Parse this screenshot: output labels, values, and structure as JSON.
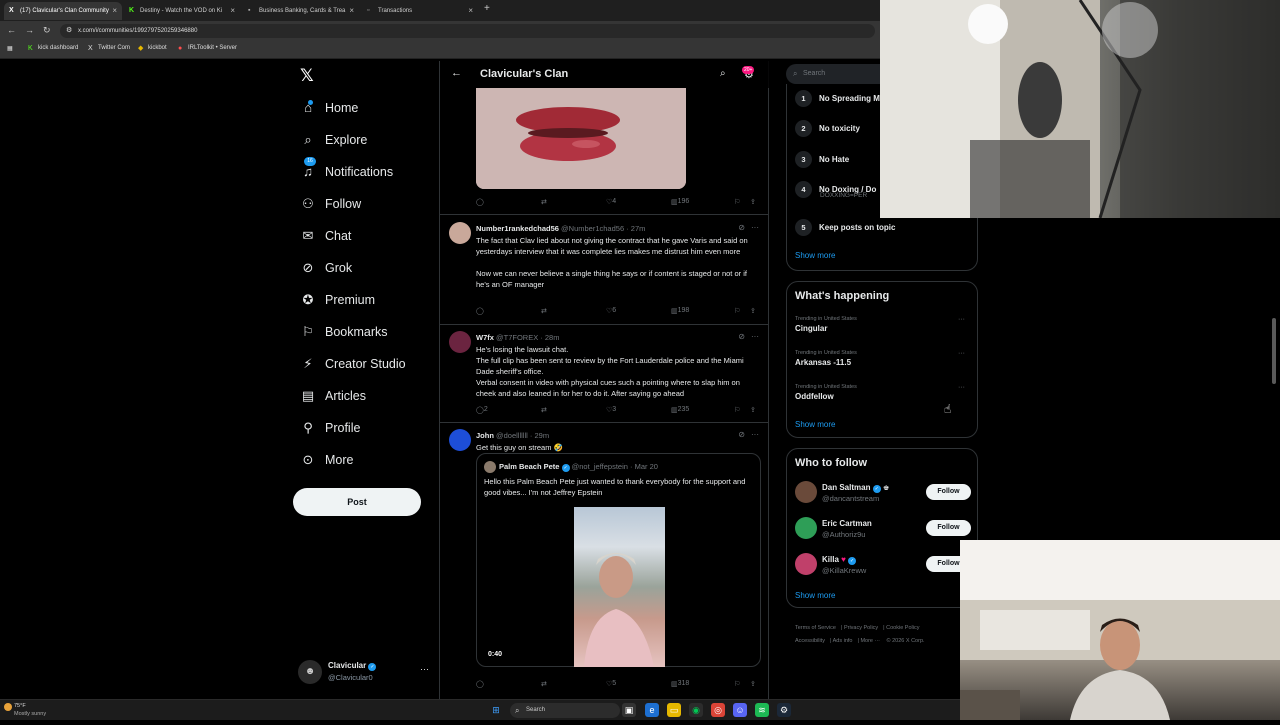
{
  "browser": {
    "tabs": [
      {
        "label": "(17) Clavicular's Clan Community",
        "icon": "x-logo-icon"
      },
      {
        "label": "Destiny - Watch the VOD on Ki",
        "icon": "kick-icon"
      },
      {
        "label": "Business Banking, Cards & Trea",
        "icon": "bank-icon"
      },
      {
        "label": "Transactions",
        "icon": "doc-icon"
      }
    ],
    "new_tab": "+",
    "url": "x.com/i/communities/1992797520259346880",
    "bookmarks": [
      "kick dashboard",
      "Twitter Com",
      "kickbot",
      "IRLToolkit • Server"
    ]
  },
  "left_nav": {
    "logo": "𝕏",
    "items": [
      {
        "label": "Home",
        "icon": "home-icon"
      },
      {
        "label": "Explore",
        "icon": "search-icon"
      },
      {
        "label": "Notifications",
        "icon": "bell-icon",
        "badge": "16"
      },
      {
        "label": "Follow",
        "icon": "add-person-icon"
      },
      {
        "label": "Chat",
        "icon": "chat-icon"
      },
      {
        "label": "Grok",
        "icon": "grok-icon"
      },
      {
        "label": "Premium",
        "icon": "premium-icon"
      },
      {
        "label": "Bookmarks",
        "icon": "bookmark-icon"
      },
      {
        "label": "Creator Studio",
        "icon": "lightning-icon"
      },
      {
        "label": "Articles",
        "icon": "article-icon"
      },
      {
        "label": "Profile",
        "icon": "person-icon"
      },
      {
        "label": "More",
        "icon": "more-circle-icon"
      }
    ],
    "post_button": "Post",
    "account": {
      "name": "Clavicular",
      "handle": "@Clavicular0"
    }
  },
  "header": {
    "title": "Clavicular's Clan",
    "count_badge": "20+"
  },
  "first_actions": {
    "replies": "",
    "reposts": "",
    "likes": "4",
    "views": "196"
  },
  "tweets": [
    {
      "name": "Number1rankedchad56",
      "meta": "@Number1chad56 · 27m",
      "body": "The fact that Clav lied about not giving the contract that he gave Varis and said on yesterdays interview that it was complete lies makes me distrust him even more\n\nNow we can never believe a single thing he says or if content is staged or not or if he's an OF manager",
      "likes": "6",
      "views": "198"
    },
    {
      "name": "W7fx",
      "meta": "@T7FOREX · 28m",
      "body": "He's losing the lawsuit chat.\nThe full clip has been sent to review by the Fort Lauderdale police and the Miami Dade sheriff's office.\nVerbal consent in video with physical cues such a pointing where to slap him on cheek and also leaned in for her to do it. After saying go ahead",
      "replies": "2",
      "likes": "3",
      "views": "235"
    },
    {
      "name": "John",
      "meta": "@doelllllll · 29m",
      "body": "Get this guy on stream 🤣",
      "likes": "5",
      "views": "318",
      "quote": {
        "name": "Palm Beach Pete",
        "meta": "@not_jeffepstein · Mar 20",
        "body": "Hello this Palm Beach Pete just wanted to thank everybody for the support and good vibes... I'm not Jeffrey Epstein",
        "video_time": "0:40"
      }
    }
  ],
  "right": {
    "search_placeholder": "Search",
    "rules": [
      {
        "num": "1",
        "label": "No Spreading M"
      },
      {
        "num": "2",
        "label": "No toxicity"
      },
      {
        "num": "3",
        "label": "No Hate"
      },
      {
        "num": "4",
        "label": "No Doxing / Do",
        "sub": "DOXXING=PER"
      },
      {
        "num": "5",
        "label": "Keep posts on topic"
      }
    ],
    "show_more": "Show more",
    "happening": {
      "title": "What's happening",
      "trends": [
        {
          "context": "Trending in United States",
          "topic": "Cingular"
        },
        {
          "context": "Trending in United States",
          "topic": "Arkansas -11.5"
        },
        {
          "context": "Trending in United States",
          "topic": "Oddfellow"
        }
      ],
      "show_more": "Show more"
    },
    "who_to_follow": {
      "title": "Who to follow",
      "users": [
        {
          "name": "Dan Saltman",
          "handle": "@dancantstream",
          "button": "Follow",
          "avatar_color": "#6a4a3a"
        },
        {
          "name": "Eric Cartman",
          "handle": "@Authoriz9u",
          "button": "Follow",
          "avatar_color": "#2e9e57"
        },
        {
          "name": "Killa",
          "handle": "@KillaKreww",
          "button": "Follow",
          "avatar_color": "#c0406a"
        }
      ],
      "show_more": "Show more"
    },
    "footer": [
      "Terms of Service",
      "Privacy Policy",
      "Cookie Policy",
      "Accessibility",
      "Ads info",
      "More ···",
      "© 2026 X Corp."
    ]
  },
  "taskbar": {
    "temp": "75°F",
    "weather": "Mostly sunny",
    "search": "Search"
  }
}
